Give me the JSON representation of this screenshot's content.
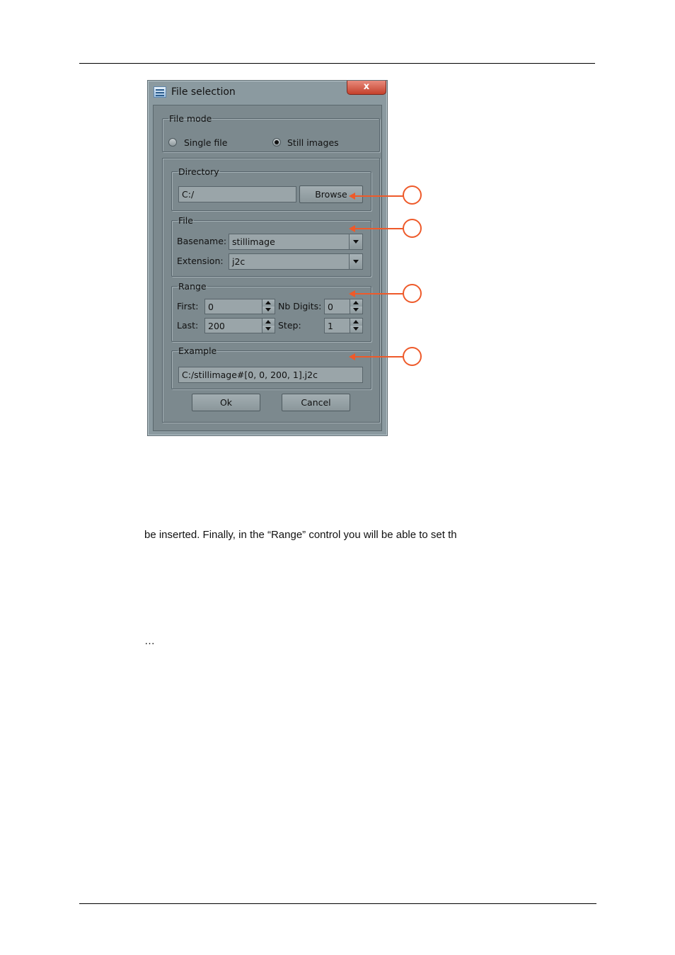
{
  "dialog": {
    "title": "File selection",
    "close_glyph": "x",
    "app_icon": "app-icon",
    "file_mode": {
      "legend": "File mode",
      "options": [
        {
          "label": "Single file",
          "selected": false
        },
        {
          "label": "Still images",
          "selected": true
        }
      ]
    },
    "directory": {
      "legend": "Directory",
      "value": "C:/",
      "browse_label": "Browse"
    },
    "file": {
      "legend": "File",
      "basename_label": "Basename:",
      "basename_value": "stillimage",
      "extension_label": "Extension:",
      "extension_value": "j2c"
    },
    "range": {
      "legend": "Range",
      "first_label": "First:",
      "first_value": "0",
      "last_label": "Last:",
      "last_value": "200",
      "nb_digits_label": "Nb Digits:",
      "nb_digits_value": "0",
      "step_label": "Step:",
      "step_value": "1"
    },
    "example": {
      "legend": "Example",
      "value": "C:/stillimage#[0, 0, 200, 1].j2c"
    },
    "ok_label": "Ok",
    "cancel_label": "Cancel"
  },
  "callout_color": "#ee5a2a",
  "document": {
    "line1": "be inserted. Finally, in the “Range” control you will be able to set th",
    "line2": "…"
  }
}
